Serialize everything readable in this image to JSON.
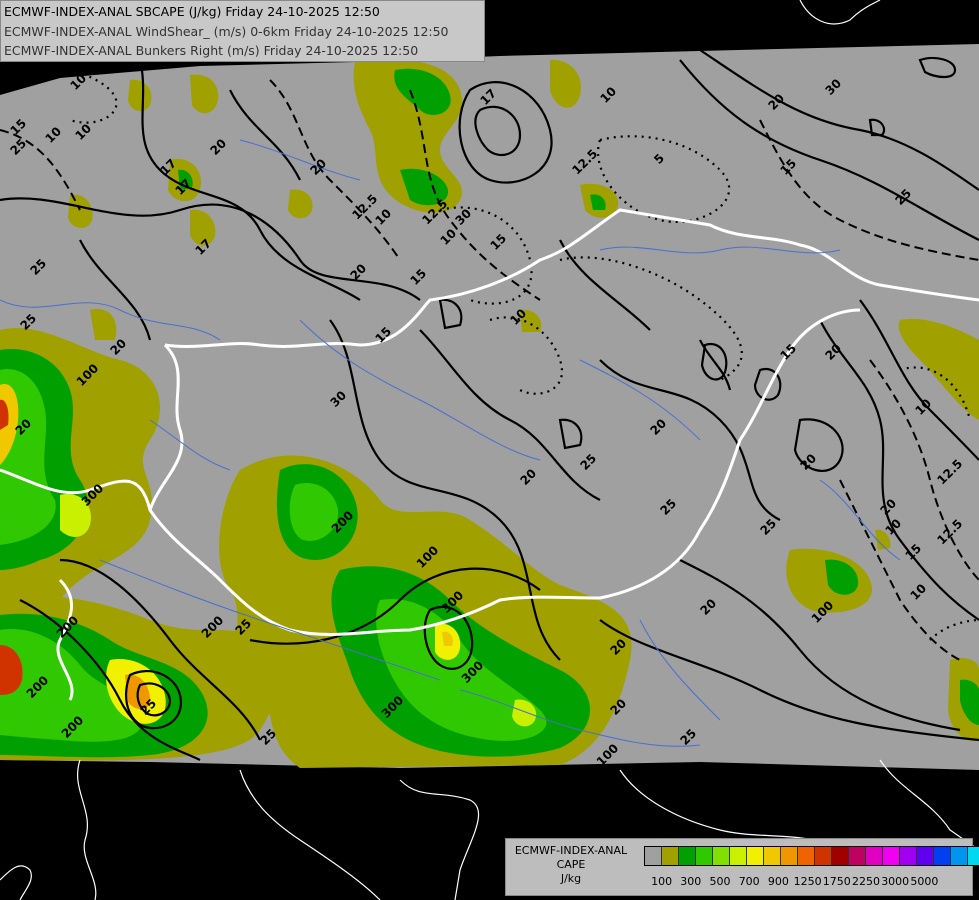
{
  "title_lines": [
    "ECMWF-INDEX-ANAL SBCAPE (J/kg) Friday 24-10-2025 12:50",
    "ECMWF-INDEX-ANAL WindShear_ (m/s) 0-6km Friday 24-10-2025 12:50",
    "ECMWF-INDEX-ANAL Bunkers Right (m/s) Friday 24-10-2025 12:50"
  ],
  "legend": {
    "title_lines": [
      "ECMWF-INDEX-ANAL",
      "CAPE",
      "J/kg"
    ],
    "colors": [
      "#a0a0a0",
      "#a0a000",
      "#00a000",
      "#30c800",
      "#80e000",
      "#c8f000",
      "#f0f000",
      "#f0c800",
      "#f09600",
      "#f06400",
      "#d03200",
      "#a00000",
      "#c00060",
      "#e000c0",
      "#f000f0",
      "#a000f0",
      "#6000f0",
      "#0040f0",
      "#0096f0",
      "#00d8f0",
      "#60fcfc",
      "#ffffff"
    ],
    "tick_labels": [
      "100",
      "300",
      "500",
      "700",
      "900",
      "1250",
      "1750",
      "2250",
      "3000",
      "5000"
    ]
  },
  "contour_labels": {
    "shear": [
      "10",
      "10",
      "25",
      "17",
      "20",
      "25",
      "20",
      "17",
      "20",
      "20",
      "25",
      "30",
      "15",
      "20",
      "25",
      "20",
      "20",
      "25",
      "20",
      "20",
      "17",
      "25",
      "25",
      "20",
      "25",
      "30",
      "20",
      "25",
      "25",
      "20",
      "25",
      "20",
      "15",
      "30",
      "20"
    ],
    "bunkers": [
      "10",
      "17",
      "12.5",
      "15",
      "10",
      "15",
      "5",
      "10",
      "12.5",
      "15",
      "10",
      "10",
      "12.5",
      "10",
      "15",
      "10",
      "12.5",
      "10",
      "15",
      "12.5"
    ],
    "cape": [
      "100",
      "300",
      "200",
      "200",
      "200",
      "300",
      "200",
      "100",
      "300",
      "300",
      "100",
      "100",
      "200"
    ]
  },
  "map_colors": {
    "background": "#000000",
    "data_area": "#a0a0a0",
    "borders": "#ffffff",
    "rivers": "#4a6fd0",
    "contours": "#000000"
  }
}
